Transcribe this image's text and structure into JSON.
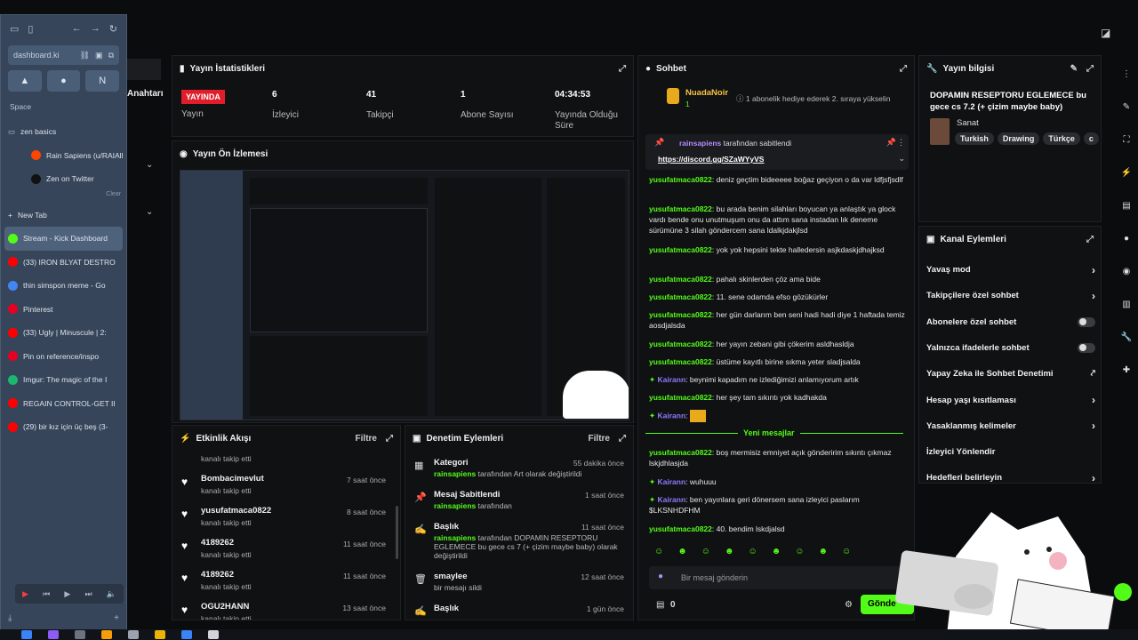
{
  "browser": {
    "url": "dashboard.ki",
    "space_label": "Space",
    "folder": "zen basics",
    "folder_items": [
      {
        "label": "Rain Sapiens (u/RAIAll",
        "icon": "reddit-icon",
        "color": "#ff4500"
      },
      {
        "label": "Zen on Twitter",
        "icon": "x-icon",
        "color": "#111"
      }
    ],
    "clear": "Clear",
    "new_tab": "New Tab",
    "tabs": [
      {
        "label": "Stream - Kick Dashboard",
        "icon": "kick-icon",
        "color": "#53fc18",
        "active": true
      },
      {
        "label": "(33) IRON BLYAT DESTRO",
        "icon": "youtube-icon",
        "color": "#ff0000"
      },
      {
        "label": "thin simspon meme - Go",
        "icon": "google-icon",
        "color": "#4285f4"
      },
      {
        "label": "Pinterest",
        "icon": "pinterest-icon",
        "color": "#e60023"
      },
      {
        "label": "(33) Ugly | Minuscule | 2:",
        "icon": "youtube-icon",
        "color": "#ff0000"
      },
      {
        "label": "Pin on reference/inspo",
        "icon": "pinterest-icon",
        "color": "#e60023"
      },
      {
        "label": "Imgur: The magic of the I",
        "icon": "imgur-icon",
        "color": "#1bb76e"
      },
      {
        "label": "REGAIN CONTROL-GET II",
        "icon": "youtube-icon",
        "color": "#ff0000"
      },
      {
        "label": "(29) bir kız için üç beş (3-",
        "icon": "youtube-icon",
        "color": "#ff0000"
      }
    ]
  },
  "left_strip": {
    "label": "Anahtarı"
  },
  "stats": {
    "title": "Yayın İstatistikleri",
    "live_badge": "YAYINDA",
    "live_label": "Yayın",
    "items": [
      {
        "value": "6",
        "label": "İzleyici"
      },
      {
        "value": "41",
        "label": "Takipçi"
      },
      {
        "value": "1",
        "label": "Abone Sayısı"
      },
      {
        "value": "04:34:53",
        "label": "Yayında Olduğu Süre"
      }
    ]
  },
  "preview": {
    "title": "Yayın Ön İzlemesi"
  },
  "activity": {
    "title": "Etkinlik Akışı",
    "filter": "Filtre",
    "followed": "kanalı takip etti",
    "rows": [
      {
        "name": "Bombacimevlut",
        "time": "7 saat önce"
      },
      {
        "name": "yusufatmaca0822",
        "time": "8 saat önce"
      },
      {
        "name": "4189262",
        "time": "11 saat önce"
      },
      {
        "name": "4189262",
        "time": "11 saat önce"
      },
      {
        "name": "OGU2HANN",
        "time": "13 saat önce"
      }
    ]
  },
  "moderation": {
    "title": "Denetim Eylemleri",
    "filter": "Filtre",
    "rows": [
      {
        "icon": "category-icon",
        "title": "Kategori",
        "time": "55 dakika önce",
        "user": "rainsapiens",
        "desc": "tarafından Art olarak değiştirildi"
      },
      {
        "icon": "pin-icon",
        "title": "Mesaj Sabitlendi",
        "time": "1 saat önce",
        "user": "rainsapiens",
        "desc": "tarafından"
      },
      {
        "icon": "title-icon",
        "title": "Başlık",
        "time": "11 saat önce",
        "user": "rainsapiens",
        "desc": "tarafından DOPAMIN RESEPTORU EGLEMECE bu gece cs 7 (+ çizim maybe baby) olarak değiştirildi"
      },
      {
        "icon": "trash-icon",
        "title": "smaylee",
        "time": "12 saat önce",
        "user": "",
        "desc": "bir mesajı sildi"
      },
      {
        "icon": "title-icon",
        "title": "Başlık",
        "time": "1 gün önce",
        "user": "",
        "desc": ""
      }
    ]
  },
  "chat": {
    "title": "Sohbet",
    "gift_user": "NuadaNoir",
    "gift_count": "1",
    "gift_text": "1 abonelik hediye ederek 2. sıraya yükselin",
    "pinned_by": "rainsapiens",
    "pinned_suffix": "tarafından sabitlendi",
    "pinned_link": "https://discord.gg/SZaWYyVS",
    "messages": [
      {
        "user": "yusufatmaca0822",
        "text": "deniz geçtim bideeeee boğaz geçiyon o da var ldfjsfjsdlf"
      },
      {
        "user": "yusufatmaca0822",
        "text": "bu arada benim silahları boyucan ya anlaştık ya glock vardı bende onu unutmuşum onu da attım sana instadan lık deneme sürümüne 3 silah göndercem sana ldalkjdakjlsd"
      },
      {
        "user": "yusufatmaca0822",
        "text": "yok yok hepsini tekte halledersin asjkdaskjdhajksd"
      },
      {
        "user": "yusufatmaca0822",
        "text": "pahalı skinlerden çöz ama bide"
      },
      {
        "user": "yusufatmaca0822",
        "text": "11. sene odamda efso gözükürler"
      },
      {
        "user": "yusufatmaca0822",
        "text": "her gün darlarım ben seni hadi hadi diye 1 haftada temiz aosdjalsda"
      },
      {
        "user": "yusufatmaca0822",
        "text": "her yayın zebani gibi çökerim asldhasldja"
      },
      {
        "user": "yusufatmaca0822",
        "text": "üstüme kayıtlı birine sıkma yeter sladjsalda"
      },
      {
        "user": "Kairann",
        "text": "beynimi kapadım ne izlediğimizi anlamıyorum artık",
        "alt": true
      },
      {
        "user": "yusufatmaca0822",
        "text": "her şey tam sıkıntı yok kadhakda"
      },
      {
        "user": "Kairann",
        "text": "",
        "alt": true
      }
    ],
    "new_messages": "Yeni mesajlar",
    "messages2": [
      {
        "user": "yusufatmaca0822",
        "text": "boş mermisiz emniyet açık gönderirim sıkıntı çıkmaz lskjdhlasjda"
      },
      {
        "user": "Kairann",
        "text": "wuhuuu",
        "alt": true
      },
      {
        "user": "Kairann",
        "text": "ben yayınlara geri dönersem sana izleyici paslarım $LKSNHDFHM",
        "alt": true
      },
      {
        "user": "yusufatmaca0822",
        "text": "40. bendim lskdjalsd"
      }
    ],
    "input_placeholder": "Bir mesaj gönderin",
    "count": "0",
    "send": "Gönde"
  },
  "info": {
    "title": "Yayın bilgisi",
    "stream_title": "DOPAMIN RESEPTORU EGLEMECE bu gece cs 7.2 (+ çizim maybe baby)",
    "category": "Sanat",
    "tags": [
      "Turkish",
      "Drawing",
      "Türkçe",
      "c"
    ]
  },
  "channel_actions": {
    "title": "Kanal Eylemleri",
    "items": [
      {
        "label": "Yavaş mod",
        "ctrl": "arrow"
      },
      {
        "label": "Takipçilere özel sohbet",
        "ctrl": "arrow"
      },
      {
        "label": "Abonelere özel sohbet",
        "ctrl": "toggle"
      },
      {
        "label": "Yalnızca ifadelerle sohbet",
        "ctrl": "toggle"
      },
      {
        "label": "Yapay Zeka ile Sohbet Denetimi",
        "ctrl": "ext"
      },
      {
        "label": "Hesap yaşı kısıtlaması",
        "ctrl": "arrow"
      },
      {
        "label": "Yasaklanmış kelimeler",
        "ctrl": "arrow"
      },
      {
        "label": "İzleyici Yönlendir",
        "ctrl": "none"
      },
      {
        "label": "Hedefleri belirleyin",
        "ctrl": "arrow"
      }
    ]
  },
  "colors": {
    "kick_green": "#53fc18",
    "live_red": "#e01e2b",
    "panel_bg": "#101113"
  }
}
